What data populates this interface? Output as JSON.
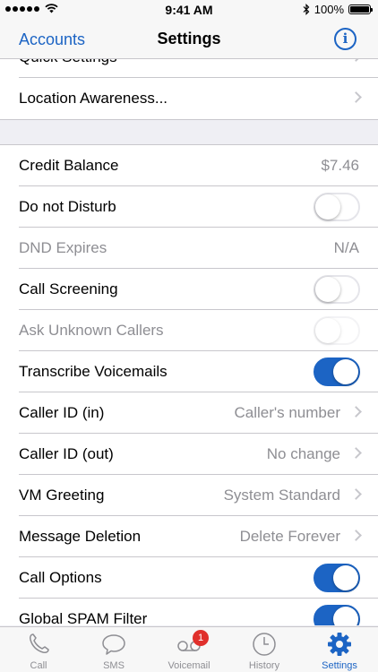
{
  "status_bar": {
    "time": "9:41 AM",
    "battery": "100%",
    "battery_level": 1.0
  },
  "nav": {
    "back_label": "Accounts",
    "title": "Settings",
    "info_glyph": "i"
  },
  "group1": [
    {
      "label": "Quick Settings",
      "chevron": true
    },
    {
      "label": "Location Awareness...",
      "chevron": true
    }
  ],
  "group2": [
    {
      "label": "Credit Balance",
      "value": "$7.46"
    },
    {
      "label": "Do not Disturb",
      "toggle": false
    },
    {
      "label": "DND Expires",
      "value": "N/A",
      "disabled": true
    },
    {
      "label": "Call Screening",
      "toggle": false
    },
    {
      "label": "Ask Unknown Callers",
      "toggle": false,
      "disabled": true
    },
    {
      "label": "Transcribe Voicemails",
      "toggle": true
    },
    {
      "label": "Caller ID (in)",
      "value": "Caller's number",
      "chevron": true
    },
    {
      "label": "Caller ID (out)",
      "value": "No change",
      "chevron": true
    },
    {
      "label": "VM Greeting",
      "value": "System Standard",
      "chevron": true
    },
    {
      "label": "Message Deletion",
      "value": "Delete Forever",
      "chevron": true
    },
    {
      "label": "Call Options",
      "toggle": true
    },
    {
      "label": "Global SPAM Filter",
      "toggle": true
    }
  ],
  "tabs": [
    {
      "label": "Call",
      "icon": "phone-icon"
    },
    {
      "label": "SMS",
      "icon": "chat-bubble-icon"
    },
    {
      "label": "Voicemail",
      "icon": "voicemail-icon",
      "badge": "1"
    },
    {
      "label": "History",
      "icon": "clock-icon"
    },
    {
      "label": "Settings",
      "icon": "gear-icon",
      "active": true
    }
  ],
  "colors": {
    "accent": "#1c64c4",
    "badge": "#e0302c",
    "secondary_text": "#8e8e93"
  }
}
